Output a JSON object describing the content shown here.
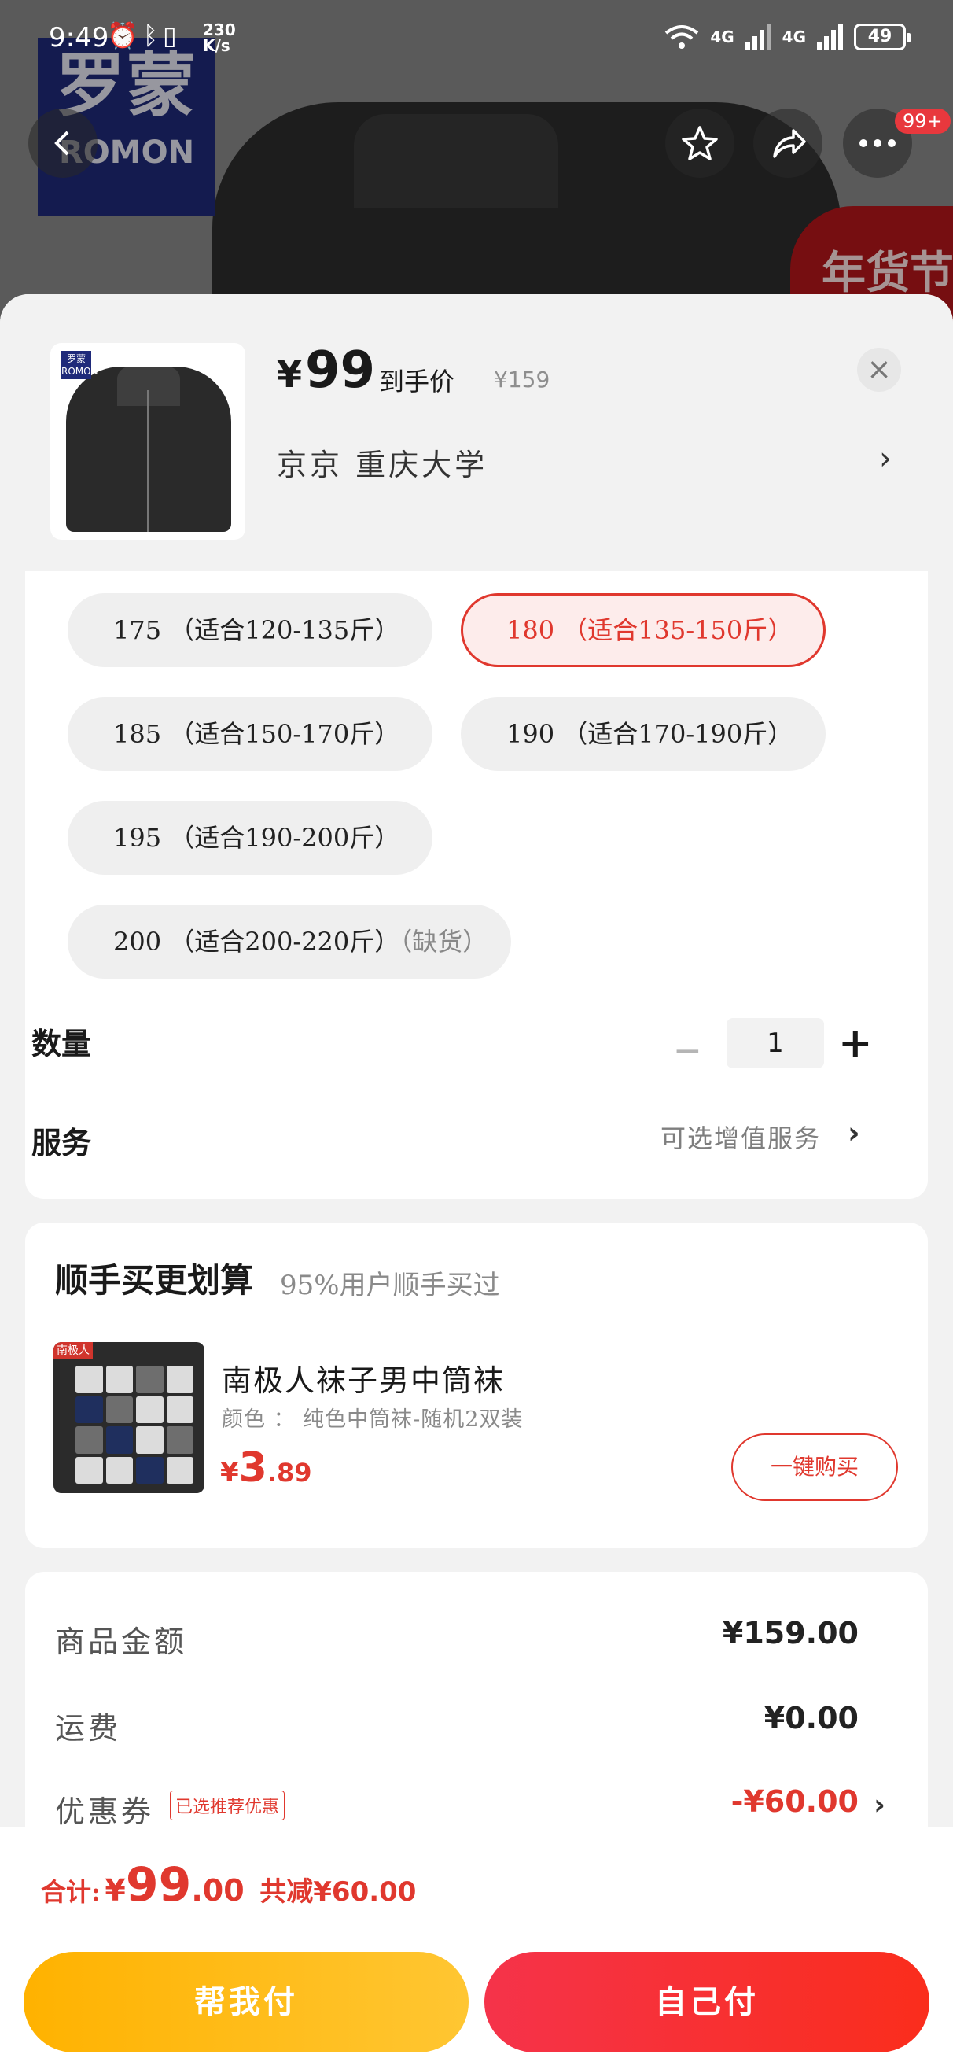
{
  "status_bar": {
    "time": "9:49",
    "net_speed_top": "230",
    "net_speed_bottom": "K/s",
    "network_1": "4G",
    "network_2": "4G",
    "battery": "49"
  },
  "background": {
    "brand_cn": "罗蒙",
    "brand_en": "ROMON",
    "banner_text": "年货节",
    "more_badge": "99+"
  },
  "product": {
    "currency": "¥",
    "price": "99",
    "price_tag": "到手价",
    "original_price": "¥159",
    "thumb_logo": "罗蒙 ROMON"
  },
  "address": {
    "text": "京京   重庆大学"
  },
  "sizes": [
    {
      "label": "175  （适合120-135斤）"
    },
    {
      "label": "180  （适合135-150斤）",
      "selected": true
    },
    {
      "label": "185  （适合150-170斤）"
    },
    {
      "label": "190  （适合170-190斤）"
    },
    {
      "label": "195  （适合190-200斤）"
    },
    {
      "label": "200  （适合200-220斤）",
      "stock_note": "（缺货）"
    }
  ],
  "quantity": {
    "label": "数量",
    "value": "1",
    "minus": "−",
    "plus": "+"
  },
  "service": {
    "label": "服务",
    "option": "可选增值服务"
  },
  "upsell": {
    "title": "顺手买更划算",
    "subtitle": "95%用户顺手买过",
    "item_name": "南极人袜子男中筒袜",
    "item_spec": "颜色 ： 纯色中筒袜-随机2双装",
    "img_tag": "南极人",
    "price_symbol": "¥",
    "price_int": "3",
    "price_dec": ".89",
    "buy_button": "一键购买"
  },
  "summary": {
    "goods_label": "商品金额",
    "goods_value": "¥159.00",
    "shipping_label": "运费",
    "shipping_value": "¥0.00",
    "coupon_label": "优惠券",
    "coupon_tag": "已选推荐优惠",
    "coupon_value": "-¥60.00"
  },
  "bottom_bar": {
    "total_label": "合计:",
    "total_symbol": "¥",
    "total_int": "99",
    "total_dec": ".00",
    "discount_text": "共减¥60.00",
    "help_pay": "帮我付",
    "self_pay": "自己付"
  },
  "colors": {
    "accent_red": "#e0382e",
    "help_gradient": "#ffb200",
    "self_gradient": "#f5334a"
  }
}
